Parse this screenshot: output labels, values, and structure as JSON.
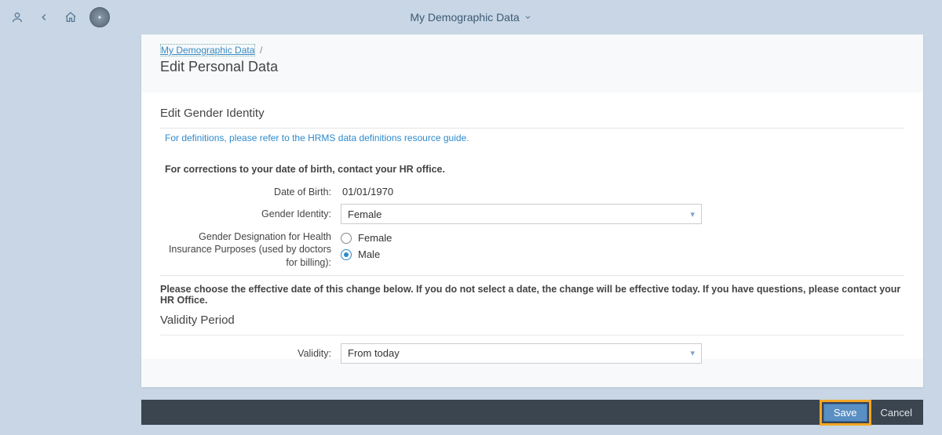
{
  "header": {
    "title": "My Demographic Data"
  },
  "breadcrumb": {
    "link_text": "My Demographic Data",
    "separator": "/"
  },
  "page_title": "Edit Personal Data",
  "section1": {
    "heading": "Edit Gender Identity",
    "resource_link": "For definitions, please refer to the HRMS data definitions resource guide.",
    "instruction": "For corrections to your date of birth, contact your HR office.",
    "dob_label": "Date of Birth:",
    "dob_value": "01/01/1970",
    "gender_identity_label": "Gender Identity:",
    "gender_identity_value": "Female",
    "gender_designation_label": "Gender Designation for Health Insurance Purposes (used by doctors for billing):",
    "radio_options": {
      "female": "Female",
      "male": "Male"
    },
    "selected_radio": "male"
  },
  "section2": {
    "instruction": "Please choose the effective date of this change below. If you do not select a date, the change will be effective today. If you have questions, please contact your HR Office.",
    "heading": "Validity Period",
    "validity_label": "Validity:",
    "validity_value": "From today"
  },
  "footer": {
    "save": "Save",
    "cancel": "Cancel"
  }
}
